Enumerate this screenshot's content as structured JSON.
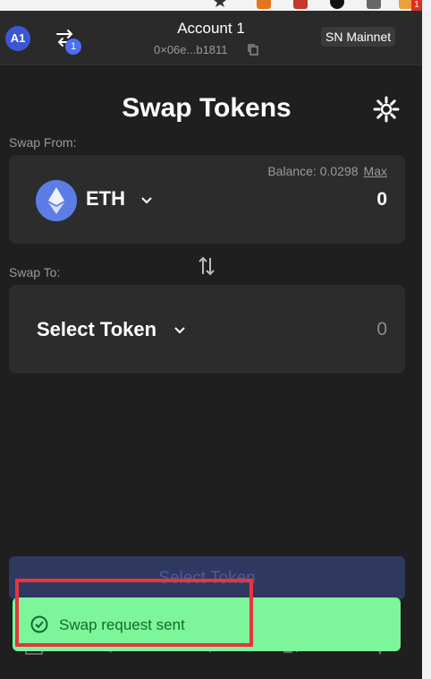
{
  "account": {
    "avatar": "A1",
    "name": "Account 1",
    "address": "0×06e...b1811",
    "pending_txn_count": "1"
  },
  "network": {
    "label": "SN Mainnet"
  },
  "page": {
    "title": "Swap Tokens"
  },
  "swap_from": {
    "label": "Swap From:",
    "balance_label": "Balance: 0.0298",
    "max_label": "Max",
    "token": "ETH",
    "amount": "0"
  },
  "swap_to": {
    "label": "Swap To:",
    "token_placeholder": "Select Token",
    "amount": "0"
  },
  "submit": {
    "label": "Select Token"
  },
  "toast": {
    "message": "Swap request sent"
  },
  "browser": {
    "extension_badge": "1"
  },
  "colors": {
    "accent": "#4c6ef5",
    "toast_bg": "#7df59b",
    "highlight": "#e8343b"
  },
  "icons": [
    "star-icon",
    "transactions-icon",
    "copy-icon",
    "gear-icon",
    "eth-icon",
    "chevron-down-icon",
    "swap-direction-icon",
    "wallet-icon",
    "chart-icon",
    "swap-icon",
    "apps-icon",
    "activity-icon",
    "check-circle-icon"
  ]
}
